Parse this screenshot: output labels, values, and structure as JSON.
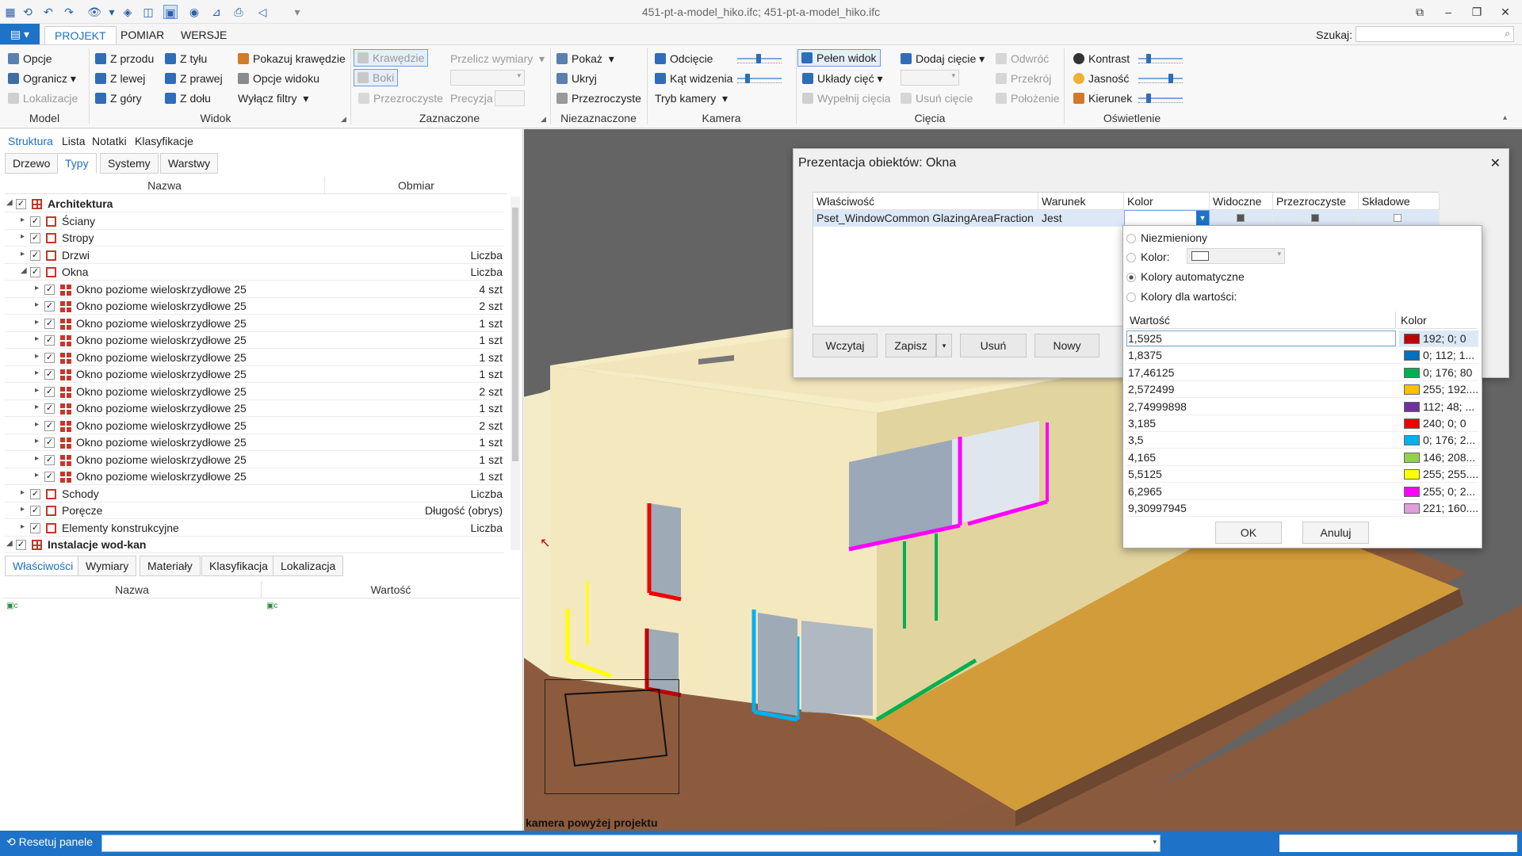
{
  "window": {
    "title": "451-pt-a-model_hiko.ifc; 451-pt-a-model_hiko.ifc"
  },
  "menu": {
    "tabs": [
      "PROJEKT",
      "POMIAR",
      "WERSJE"
    ],
    "search_label": "Szukaj:"
  },
  "ribbon": {
    "model": {
      "label": "Model",
      "opcje": "Opcje",
      "ogranicz": "Ogranicz",
      "lokalizacje": "Lokalizacje"
    },
    "widok": {
      "label": "Widok",
      "z_przodu": "Z przodu",
      "z_tylu": "Z tyłu",
      "z_lewej": "Z lewej",
      "z_prawej": "Z prawej",
      "z_gory": "Z góry",
      "z_dolu": "Z dołu",
      "pokazuj_krawedzie": "Pokazuj krawędzie",
      "opcje_widoku": "Opcje widoku",
      "wylacz_filtry": "Wyłącz filtry"
    },
    "zaznaczone": {
      "label": "Zaznaczone",
      "krawedzie": "Krawędzie",
      "boki": "Boki",
      "przezroczyste": "Przezroczyste",
      "przelicz_wymiary": "Przelicz wymiary",
      "precyzja": "Precyzja"
    },
    "niezaznaczone": {
      "label": "Niezaznaczone",
      "pokaz": "Pokaż",
      "ukryj": "Ukryj",
      "przezroczyste": "Przezroczyste"
    },
    "kamera": {
      "label": "Kamera",
      "odciecie": "Odcięcie",
      "kat_widzenia": "Kąt widzenia",
      "tryb_kamery": "Tryb kamery"
    },
    "ciecia": {
      "label": "Cięcia",
      "pelen_widok": "Pełen widok",
      "uklady_ciec": "Układy cięć",
      "wypelnij_ciecia": "Wypełnij cięcia",
      "dodaj_ciecie": "Dodaj cięcie",
      "usun_ciecie": "Usuń cięcie",
      "odwroc": "Odwróć",
      "przekroj": "Przekrój",
      "polozenie": "Położenie"
    },
    "oswietlenie": {
      "label": "Oświetlenie",
      "kontrast": "Kontrast",
      "jasnosc": "Jasność",
      "kierunek": "Kierunek"
    }
  },
  "left_panel": {
    "top_tabs": [
      "Struktura",
      "Lista",
      "Notatki",
      "Klasyfikacje"
    ],
    "sub_tabs": [
      "Drzewo",
      "Typy",
      "Systemy",
      "Warstwy"
    ],
    "columns": {
      "name": "Nazwa",
      "measure": "Obmiar"
    },
    "rows": [
      {
        "level": 0,
        "label": "Architektura",
        "measure": "",
        "bold": true,
        "icon": "group",
        "expanded": true
      },
      {
        "level": 1,
        "label": "Ściany",
        "measure": "",
        "icon": "category"
      },
      {
        "level": 1,
        "label": "Stropy",
        "measure": "",
        "icon": "category"
      },
      {
        "level": 1,
        "label": "Drzwi",
        "measure": "Liczba",
        "icon": "category"
      },
      {
        "level": 1,
        "label": "Okna",
        "measure": "Liczba",
        "icon": "category",
        "expanded": true
      },
      {
        "level": 2,
        "label": "Okno poziome wieloskrzydłowe 25",
        "measure": "4 szt",
        "icon": "window"
      },
      {
        "level": 2,
        "label": "Okno poziome wieloskrzydłowe 25",
        "measure": "2 szt",
        "icon": "window"
      },
      {
        "level": 2,
        "label": "Okno poziome wieloskrzydłowe 25",
        "measure": "1 szt",
        "icon": "window"
      },
      {
        "level": 2,
        "label": "Okno poziome wieloskrzydłowe 25",
        "measure": "1 szt",
        "icon": "window"
      },
      {
        "level": 2,
        "label": "Okno poziome wieloskrzydłowe 25",
        "measure": "1 szt",
        "icon": "window"
      },
      {
        "level": 2,
        "label": "Okno poziome wieloskrzydłowe 25",
        "measure": "1 szt",
        "icon": "window"
      },
      {
        "level": 2,
        "label": "Okno poziome wieloskrzydłowe 25",
        "measure": "2 szt",
        "icon": "window"
      },
      {
        "level": 2,
        "label": "Okno poziome wieloskrzydłowe 25",
        "measure": "1 szt",
        "icon": "window"
      },
      {
        "level": 2,
        "label": "Okno poziome wieloskrzydłowe 25",
        "measure": "2 szt",
        "icon": "window"
      },
      {
        "level": 2,
        "label": "Okno poziome wieloskrzydłowe 25",
        "measure": "1 szt",
        "icon": "window"
      },
      {
        "level": 2,
        "label": "Okno poziome wieloskrzydłowe 25",
        "measure": "1 szt",
        "icon": "window"
      },
      {
        "level": 2,
        "label": "Okno poziome wieloskrzydłowe 25",
        "measure": "1 szt",
        "icon": "window"
      },
      {
        "level": 1,
        "label": "Schody",
        "measure": "Liczba",
        "icon": "category"
      },
      {
        "level": 1,
        "label": "Poręcze",
        "measure": "Długość (obrys)",
        "icon": "category"
      },
      {
        "level": 1,
        "label": "Elementy konstrukcyjne",
        "measure": "Liczba",
        "icon": "category"
      },
      {
        "level": 0,
        "label": "Instalacje wod-kan",
        "measure": "",
        "bold": true,
        "icon": "group",
        "expanded": true
      }
    ],
    "bottom_tabs": [
      "Właściwości",
      "Wymiary",
      "Materiały",
      "Klasyfikacja",
      "Lokalizacja"
    ],
    "prop_columns": {
      "name": "Nazwa",
      "value": "Wartość"
    }
  },
  "viewport": {
    "camera_label": "kamera powyżej projektu"
  },
  "status": {
    "reset_label": "Resetuj panele"
  },
  "dialog": {
    "title": "Prezentacja obiektów: Okna",
    "columns": [
      "Właściwość",
      "Warunek",
      "Kolor",
      "Widoczne",
      "Przezroczyste",
      "Składowe"
    ],
    "row": {
      "property": "Pset_WindowCommon GlazingAreaFraction",
      "condition": "Jest"
    },
    "buttons": {
      "load": "Wczytaj",
      "save": "Zapisz",
      "delete": "Usuń",
      "new": "Nowy"
    }
  },
  "color_popup": {
    "options": [
      "Niezmieniony",
      "Kolor:",
      "Kolory automatyczne",
      "Kolory dla wartości:"
    ],
    "selected_option": 2,
    "columns": {
      "value": "Wartość",
      "color": "Kolor"
    },
    "rows": [
      {
        "value": "1,5925",
        "color_text": "192; 0; 0",
        "hex": "#c00000"
      },
      {
        "value": "1,8375",
        "color_text": "0; 112; 1...",
        "hex": "#0070c0"
      },
      {
        "value": "17,46125",
        "color_text": "0; 176; 80",
        "hex": "#00b050"
      },
      {
        "value": "2,572499",
        "color_text": "255; 192....",
        "hex": "#ffc000"
      },
      {
        "value": "2,74999898",
        "color_text": "112; 48; ...",
        "hex": "#7030a0"
      },
      {
        "value": "3,185",
        "color_text": "240; 0; 0",
        "hex": "#f00000"
      },
      {
        "value": "3,5",
        "color_text": "0; 176; 2...",
        "hex": "#00b0f0"
      },
      {
        "value": "4,165",
        "color_text": "146; 208...",
        "hex": "#92d050"
      },
      {
        "value": "5,5125",
        "color_text": "255; 255....",
        "hex": "#ffff00"
      },
      {
        "value": "6,2965",
        "color_text": "255; 0; 2...",
        "hex": "#ff00ff"
      },
      {
        "value": "9,30997945",
        "color_text": "221; 160....",
        "hex": "#dda0dd"
      }
    ],
    "ok": "OK",
    "cancel": "Anuluj"
  },
  "colors": {
    "accent": "#1e73c8",
    "selection": "#dce8f6"
  }
}
